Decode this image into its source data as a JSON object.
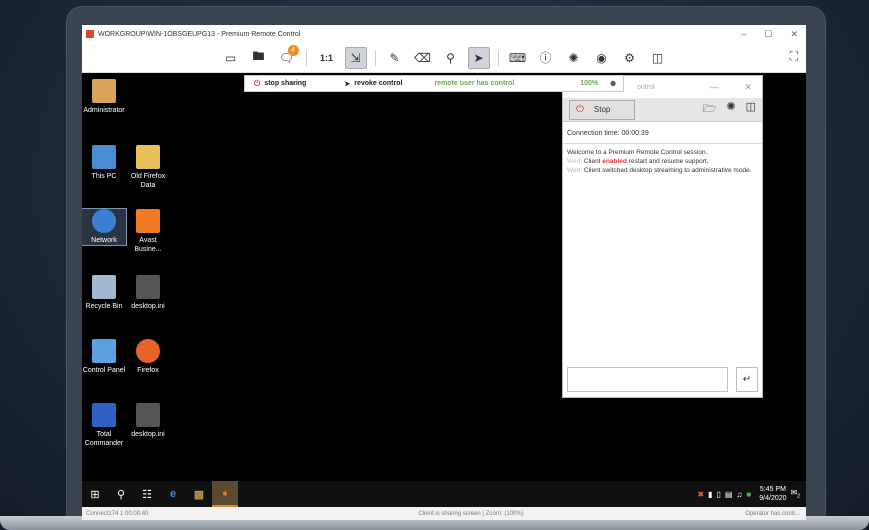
{
  "window": {
    "title": "WORKGROUP\\WIN-1OBSGEUPG13 - Premium Remote Control",
    "minimize": "–",
    "maximize": "☐",
    "close": "✕"
  },
  "toolbar": {
    "notification_count": "4",
    "ratio_label": "1:1",
    "fullscreen_icon": "fullscreen-icon"
  },
  "sharebar": {
    "stop_sharing": "stop sharing",
    "revoke_control": "revoke control",
    "status": "remote user has control",
    "percent": "100%",
    "status_color": "#6aa84f"
  },
  "desktop_icons": [
    {
      "label": "Administrator",
      "color": "#d7a45a"
    },
    {
      "label": "This PC",
      "color": "#4a8fd6"
    },
    {
      "label": "Old Firefox Data",
      "color": "#e8c15a"
    },
    {
      "label": "Network",
      "color": "#3b7fd1"
    },
    {
      "label": "Avast Busine...",
      "color": "#f07a22"
    },
    {
      "label": "Recycle Bin",
      "color": "#9fb8d0"
    },
    {
      "label": "desktop.ini",
      "color": "#555"
    },
    {
      "label": "Control Panel",
      "color": "#5aa0e0"
    },
    {
      "label": "Firefox",
      "color": "#e8622a"
    },
    {
      "label": "Total Commander",
      "color": "#2d62c4"
    },
    {
      "label": "desktop.ini",
      "color": "#555"
    }
  ],
  "panel": {
    "title_suffix": "ontrol",
    "stop_label": "Stop",
    "connection_time": "Connection time: 00:00:39",
    "log": {
      "line1": "Welcome to a Premium Remote Control session.",
      "line2_ts": "Wed:",
      "line2_pre": " Client ",
      "line2_hl": "enabled",
      "line2_post": " restart and resume support.",
      "line3_ts": "Wed:",
      "line3_text": " Client switched desktop streaming to administrative mode."
    },
    "send_icon": "enter-icon",
    "accent": "#d33333"
  },
  "taskbar": {
    "clock_time": "5:45 PM",
    "clock_date": "9/4/2020",
    "notif_count": "2"
  },
  "statusbar": {
    "left": "Connect174 1 00:00:40",
    "middle": "Client is sharing screen | Zoom: (100%)",
    "right": "Operator has contr..."
  }
}
